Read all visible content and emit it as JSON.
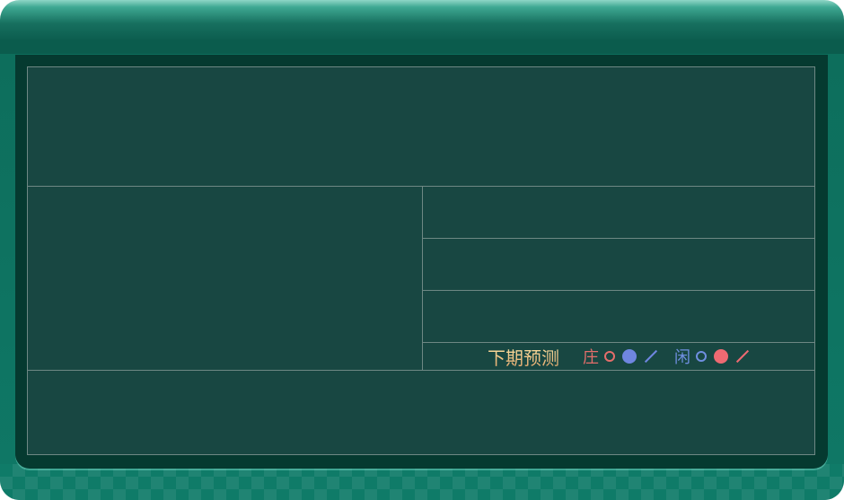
{
  "predict": {
    "title": "下期预测",
    "banker": {
      "label": "庄",
      "ring_color": "#e46e6b",
      "dot_color": "#6f86e0",
      "slash_color": "#6f86e0",
      "label_color": "#e46e6b"
    },
    "player": {
      "label": "闲",
      "ring_color": "#6f8fe0",
      "dot_color": "#ee6a72",
      "slash_color": "#ee6a72",
      "label_color": "#6f8fe0"
    }
  },
  "colors": {
    "board_bg": "#184742",
    "grid_line": "#6e8884",
    "frame_accent": "#0f7866"
  },
  "icons": {
    "ring": "hollow-circle-icon",
    "dot": "solid-circle-icon",
    "slash": "slash-icon"
  }
}
